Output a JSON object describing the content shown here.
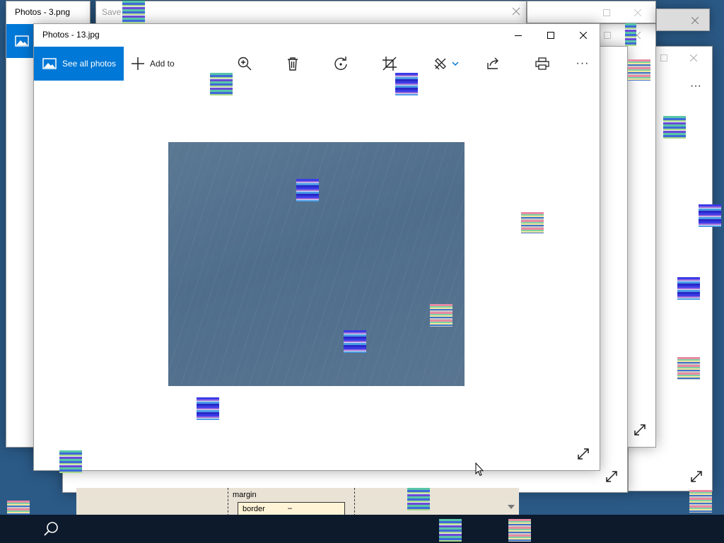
{
  "back_windows": {
    "photos3": {
      "title": "Photos - 3.png"
    },
    "save_dialog": {
      "title": "Save"
    },
    "css_panel": {
      "margin_label": "margin",
      "border_label": "border",
      "border_value": "–",
      "margin_value": "–"
    }
  },
  "main_window": {
    "title": "Photos - 13.jpg",
    "caption": {
      "minimize": "minimize-icon",
      "maximize": "maximize-icon",
      "close": "close-icon"
    },
    "toolbar": {
      "see_all_label": "See all photos",
      "add_to_label": "Add to",
      "more_label": "···"
    },
    "photo_alt": "blue-gray rainy sky"
  },
  "colors": {
    "accent": "#0078d7",
    "desktop": "#2b5a87",
    "taskbar": "#0c1a2c"
  },
  "taskbar": {
    "search_icon": "search-icon"
  },
  "more_label": "···"
}
